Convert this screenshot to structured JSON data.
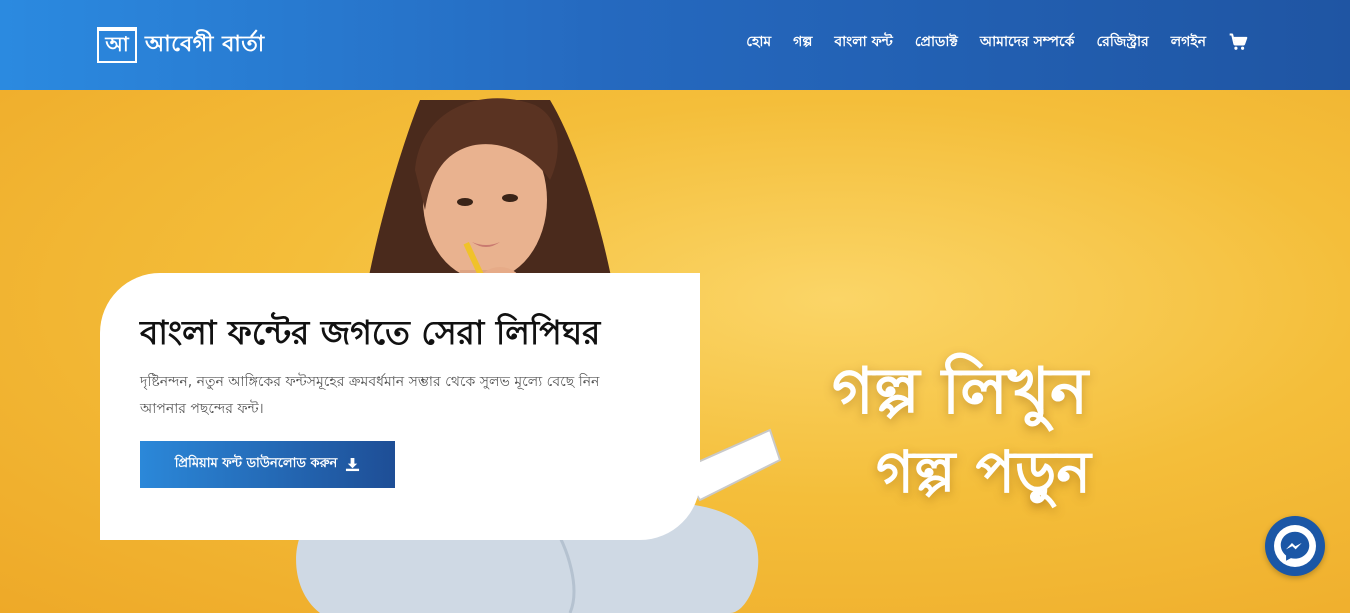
{
  "header": {
    "logo_mark": "আ",
    "logo_text": "আবেগী বার্তা",
    "nav": [
      {
        "label": "হোম"
      },
      {
        "label": "গল্প"
      },
      {
        "label": "বাংলা ফন্ট"
      },
      {
        "label": "প্রোডাক্ট"
      },
      {
        "label": "আমাদের সম্পর্কে"
      },
      {
        "label": "রেজিস্ট্রার"
      },
      {
        "label": "লগইন"
      }
    ],
    "cart_icon": "cart-icon"
  },
  "hero": {
    "title": "বাংলা ফন্টের জগতে সেরা লিপিঘর",
    "subtitle": "দৃষ্টিনন্দন, নতুন আঙ্গিকের ফন্টসমূহের ক্রমবর্ধমান সম্ভার থেকে সুলভ মূল্যে বেছে নিন আপনার পছন্দের ফন্ট।",
    "button_label": "প্রিমিয়াম ফন্ট ডাউনলোড করুন",
    "button_icon": "download-icon",
    "slogan_line1": "গল্প লিখুন",
    "slogan_line2": "গল্প পড়ুন"
  },
  "colors": {
    "header_start": "#2b8ae0",
    "header_end": "#1f55a3",
    "hero_bg": "#f4be3a",
    "button_start": "#2b88d9",
    "button_end": "#1e4e96",
    "messenger": "#1b57a6"
  },
  "chat_widget": {
    "icon": "messenger-icon"
  }
}
